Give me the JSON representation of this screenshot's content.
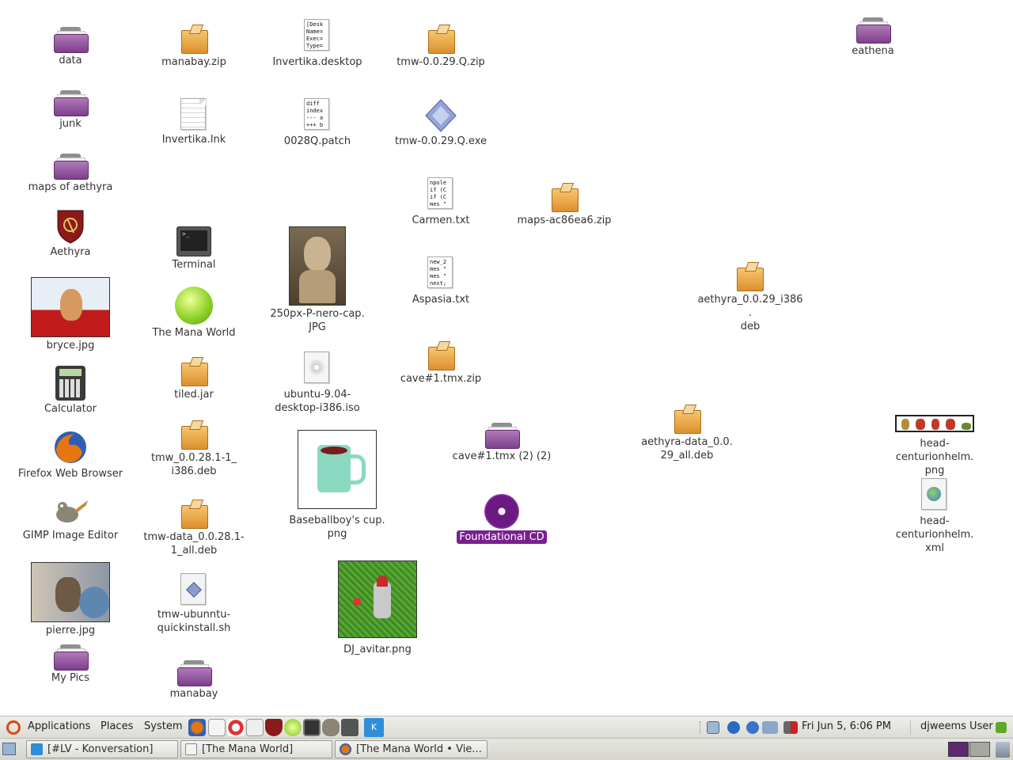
{
  "desktop": {
    "icons": {
      "data": "data",
      "junk": "junk",
      "maps_of_aethyra": "maps of aethyra",
      "aethyra": "Aethyra",
      "bryce": "bryce.jpg",
      "calculator": "Calculator",
      "firefox": "Firefox Web Browser",
      "gimp": "GIMP Image Editor",
      "pierre": "pierre.jpg",
      "my_pics": "My Pics",
      "manabay_zip": "manabay.zip",
      "invertika_lnk": "Invertika.lnk",
      "terminal": "Terminal",
      "mana_world": "The Mana World",
      "tiled_jar": "tiled.jar",
      "tmw_0028_deb_1": "tmw_0.0.28.1-1_",
      "tmw_0028_deb_2": "i386.deb",
      "tmwdata_deb_1": "tmw-data_0.0.28.1-",
      "tmwdata_deb_2": "1_all.deb",
      "quickinstall_1": "tmw-ubunntu-",
      "quickinstall_2": "quickinstall.sh",
      "manabay": "manabay",
      "invertika_desktop": "Invertika.desktop",
      "patch": "0028Q.patch",
      "nero_1": "250px-P-nero-cap.",
      "nero_2": "JPG",
      "ubuntu_iso_1": "ubuntu-9.04-",
      "ubuntu_iso_2": "desktop-i386.iso",
      "baseballboy_1": "Baseballboy's cup.",
      "baseballboy_2": "png",
      "dj_avatar": "DJ_avitar.png",
      "tmw_zip": "tmw-0.0.29.Q.zip",
      "tmw_exe": "tmw-0.0.29.Q.exe",
      "carmen": "Carmen.txt",
      "aspasia": "Aspasia.txt",
      "cave_zip": "cave#1.tmx.zip",
      "cave_folder": "cave#1.tmx (2) (2)",
      "foundational_cd": "Foundational CD",
      "maps_zip": "maps-ac86ea6.zip",
      "aethyra_deb_1": "aethyra_0.0.29_i386.",
      "aethyra_deb_2": "deb",
      "aethyra_data_1": "aethyra-data_0.0.",
      "aethyra_data_2": "29_all.deb",
      "eathena": "eathena",
      "helm_png_1": "head-centurionhelm.",
      "helm_png_2": "png",
      "helm_xml_1": "head-centurionhelm.",
      "helm_xml_2": "xml"
    },
    "file_previews": {
      "invertika_desktop": "[Desk\nName=\nExec=\nType=",
      "patch": "diff\nindex\n--- a\n+++ b",
      "carmen": "npole\nif (C\nif (C\nmes \"",
      "aspasia": "new_2\nmes \"\nmes \"\nnext;"
    }
  },
  "top_panel": {
    "menus": [
      "Applications",
      "Places",
      "System"
    ],
    "clock": "Fri Jun  5,  6:06 PM",
    "user": "djweems User"
  },
  "bottom_panel": {
    "tasks": [
      "[#LV - Konversation]",
      "[The Mana World]",
      "[The Mana World • Vie..."
    ]
  },
  "colors": {
    "selection": "#7a1f8e",
    "folder": "#8a4a99",
    "package": "#e8a547",
    "panel": "#e4e4de"
  }
}
